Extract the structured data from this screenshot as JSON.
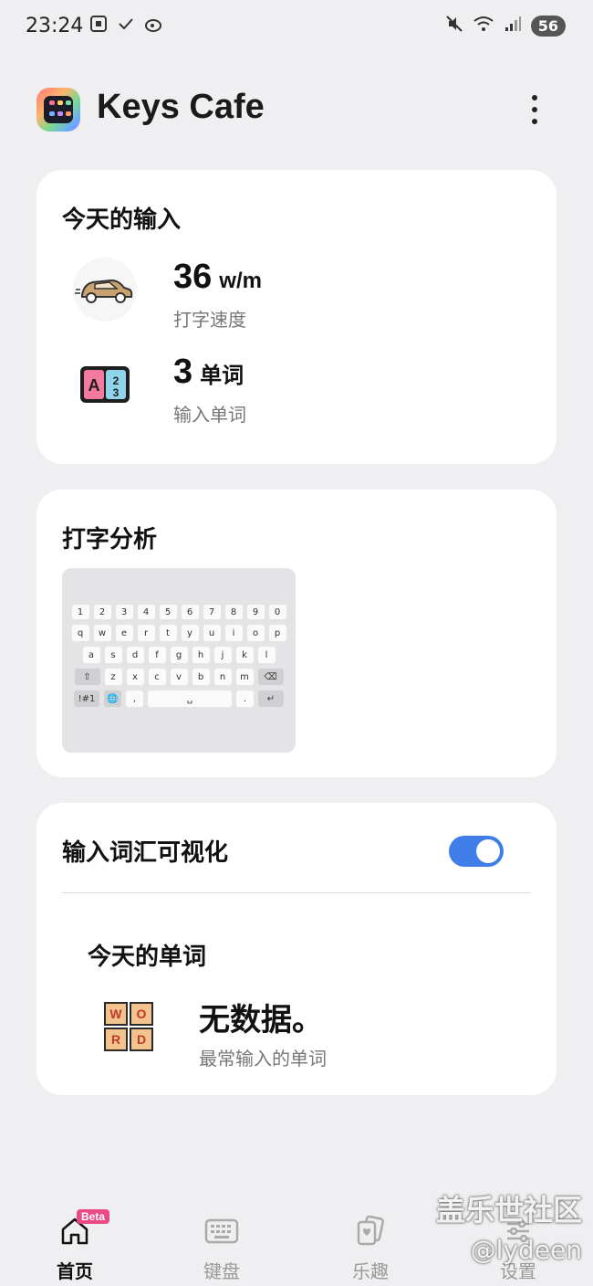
{
  "status_bar": {
    "time": "23:24",
    "battery": "56",
    "left_icons": [
      "screenshot-icon",
      "check-icon",
      "weibo-icon"
    ],
    "right_icons": [
      "mute-icon",
      "wifi-icon",
      "signal-icon"
    ]
  },
  "header": {
    "title": "Keys Cafe",
    "menu_icon": "more-vertical-icon"
  },
  "today_input": {
    "title": "今天的输入",
    "speed": {
      "value": "36",
      "unit": "w/m",
      "label": "打字速度",
      "icon": "car-icon"
    },
    "words": {
      "value": "3",
      "unit": "单词",
      "label": "输入单词",
      "icon": "abc-blocks-icon"
    }
  },
  "typing_analysis": {
    "title": "打字分析",
    "keyboard_rows": [
      [
        "1",
        "2",
        "3",
        "4",
        "5",
        "6",
        "7",
        "8",
        "9",
        "0"
      ],
      [
        "q",
        "w",
        "e",
        "r",
        "t",
        "y",
        "u",
        "i",
        "o",
        "p"
      ],
      [
        "a",
        "s",
        "d",
        "f",
        "g",
        "h",
        "j",
        "k",
        "l"
      ],
      [
        "⇧",
        "z",
        "x",
        "c",
        "v",
        "b",
        "n",
        "m",
        "⌫"
      ],
      [
        "!#1",
        "🌐",
        ",",
        "␣",
        ".",
        "↵"
      ]
    ]
  },
  "vocab": {
    "toggle_label": "输入词汇可视化",
    "toggle_on": true,
    "today_words_title": "今天的单词",
    "empty_title": "无数据。",
    "empty_subtitle": "最常输入的单词",
    "tiles": [
      "W",
      "O",
      "R",
      "D"
    ]
  },
  "bottom_nav": [
    {
      "label": "首页",
      "icon": "home-icon",
      "active": true,
      "badge": "Beta"
    },
    {
      "label": "键盘",
      "icon": "keyboard-icon",
      "active": false
    },
    {
      "label": "乐趣",
      "icon": "cards-icon",
      "active": false
    },
    {
      "label": "设置",
      "icon": "settings-icon",
      "active": false
    }
  ],
  "watermark": {
    "line1": "盖乐世社区",
    "line2": "@lydeen"
  },
  "colors": {
    "background": "#efeff1",
    "toggle": "#3f7de8",
    "beta_badge": "#e94b86"
  }
}
